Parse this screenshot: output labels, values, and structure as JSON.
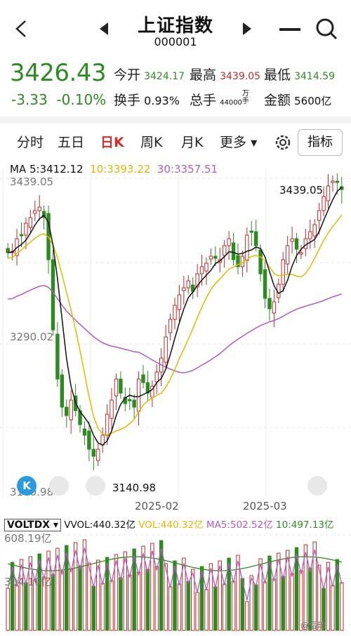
{
  "header": {
    "title": "上证指数",
    "code": "000001"
  },
  "quote": {
    "price": "3426.43",
    "change": "-3.33",
    "change_pct": "-0.10%",
    "open_label": "今开",
    "open_value": "3424.17",
    "high_label": "最高",
    "high_value": "3439.05",
    "low_label": "最低",
    "low_value": "3414.59",
    "turnover_label": "换手",
    "turnover_value": "0.93%",
    "total_label": "总手",
    "total_value": "44000",
    "total_unit": "万手",
    "amount_label": "金额",
    "amount_value": "5600亿"
  },
  "tabs": [
    {
      "label": "分时"
    },
    {
      "label": "五日"
    },
    {
      "label": "日K"
    },
    {
      "label": "周K"
    },
    {
      "label": "月K"
    },
    {
      "label": "更多"
    }
  ],
  "indicator_button": "指标",
  "ma": {
    "ma5": "MA  5:3412.12",
    "ma10": "10:3393.22",
    "ma30": "30:3357.51",
    "color_ma5": "#111111",
    "color_ma10": "#e6b800",
    "color_ma30": "#b25bc0"
  },
  "axis": {
    "top_price": "3439.05",
    "mid_price": "3290.02",
    "low_price": "3140.98",
    "high_marker": "3439.05",
    "low_marker": "3140.98",
    "date1": "2025-02",
    "date2": "2025-03"
  },
  "volume": {
    "indicator": "VOLTDX",
    "vvol": "VVOL:440.32亿",
    "vol": "VOL:440.32亿",
    "ma5": "MA5:502.52亿",
    "ma10": "10:497.13亿",
    "axis_top": "608.19亿",
    "axis_mid": "304.10亿"
  },
  "watermark": "@雪球",
  "colors": {
    "up": "#c62828",
    "down": "#2e8b22"
  }
}
